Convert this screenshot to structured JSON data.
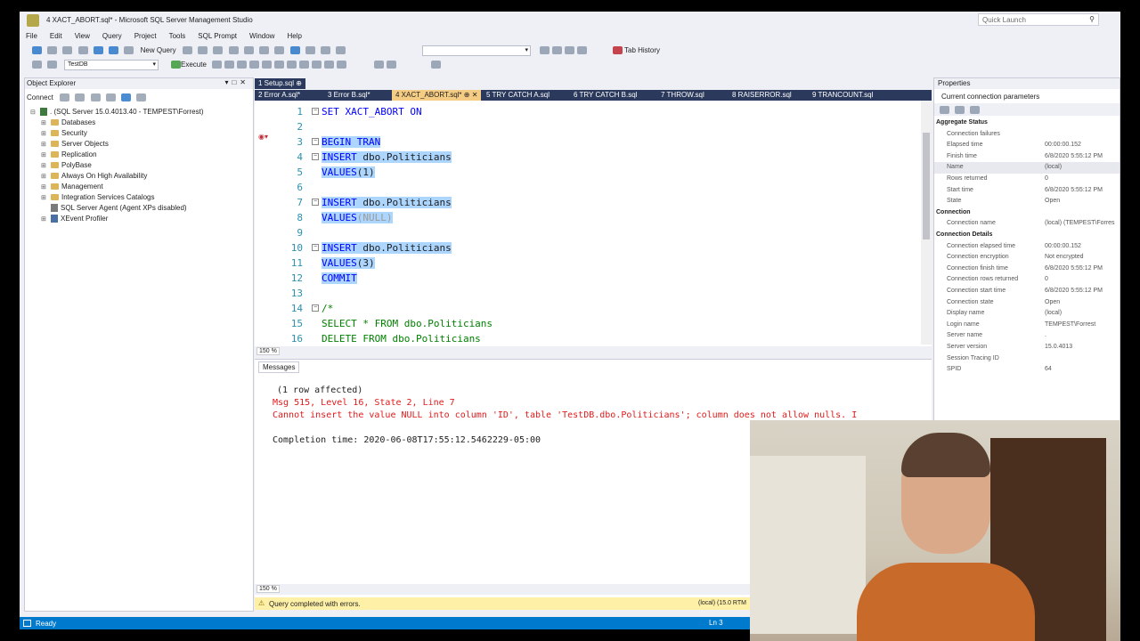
{
  "window": {
    "title": "4 XACT_ABORT.sql* - Microsoft SQL Server Management Studio",
    "quick_launch_placeholder": "Quick Launch"
  },
  "menu": [
    "File",
    "Edit",
    "View",
    "Query",
    "Project",
    "Tools",
    "SQL Prompt",
    "Window",
    "Help"
  ],
  "toolbar": {
    "new_query": "New Query",
    "tab_history": "Tab History",
    "database": "TestDB",
    "execute": "Execute"
  },
  "object_explorer": {
    "title": "Object Explorer",
    "connect": "Connect",
    "server": ". (SQL Server 15.0.4013.40 - TEMPEST\\Forrest)",
    "nodes": [
      "Databases",
      "Security",
      "Server Objects",
      "Replication",
      "PolyBase",
      "Always On High Availability",
      "Management",
      "Integration Services Catalogs"
    ],
    "agent": "SQL Server Agent (Agent XPs disabled)",
    "xevent": "XEvent Profiler"
  },
  "tabs": [
    {
      "label": "1 Setup.sql"
    },
    {
      "label": "2 Error A.sql*"
    },
    {
      "label": "3 Error B.sql*"
    },
    {
      "label": "4 XACT_ABORT.sql*"
    },
    {
      "label": "5 TRY CATCH A.sql"
    },
    {
      "label": "6 TRY CATCH B.sql"
    },
    {
      "label": "7 THROW.sql"
    },
    {
      "label": "8 RAISERROR.sql"
    },
    {
      "label": "9 TRANCOUNT.sql"
    }
  ],
  "editor": {
    "zoom": "150 %",
    "lines": [
      {
        "n": "1",
        "text": "SET XACT_ABORT ON"
      },
      {
        "n": "2",
        "text": ""
      },
      {
        "n": "3",
        "text": "BEGIN TRAN"
      },
      {
        "n": "4",
        "kw": "INSERT",
        "obj": "dbo.Politicians"
      },
      {
        "n": "5",
        "kw": "VALUES",
        "val": "(1)"
      },
      {
        "n": "6",
        "text": ""
      },
      {
        "n": "7",
        "kw": "INSERT",
        "obj": "dbo.Politicians"
      },
      {
        "n": "8",
        "kw": "VALUES",
        "val": "(NULL)"
      },
      {
        "n": "9",
        "text": ""
      },
      {
        "n": "10",
        "kw": "INSERT",
        "obj": "dbo.Politicians"
      },
      {
        "n": "11",
        "kw": "VALUES",
        "val": "(3)"
      },
      {
        "n": "12",
        "text": "COMMIT"
      },
      {
        "n": "13",
        "text": ""
      },
      {
        "n": "14",
        "text": "/*"
      },
      {
        "n": "15",
        "text": "SELECT * FROM dbo.Politicians"
      },
      {
        "n": "16",
        "text": "DELETE FROM dbo.Politicians"
      }
    ]
  },
  "results": {
    "tab": "Messages",
    "line1": "(1 row affected)",
    "line2": "Msg 515, Level 16, State 2, Line 7",
    "line3": "Cannot insert the value NULL into column 'ID', table 'TestDB.dbo.Politicians'; column does not allow nulls. I",
    "line4": "Completion time: 2020-06-08T17:55:12.5462229-05:00",
    "zoom": "150 %",
    "status": "Query completed with errors.",
    "connection": "(local) (15.0 RTM"
  },
  "properties": {
    "title": "Properties",
    "subtitle": "Current connection parameters",
    "rows": [
      {
        "cat": true,
        "k": "Aggregate Status"
      },
      {
        "k": "Connection failures",
        "v": ""
      },
      {
        "k": "Elapsed time",
        "v": "00:00:00.152"
      },
      {
        "k": "Finish time",
        "v": "6/8/2020 5:55:12 PM"
      },
      {
        "k": "Name",
        "v": "(local)",
        "hl": true
      },
      {
        "k": "Rows returned",
        "v": "0"
      },
      {
        "k": "Start time",
        "v": "6/8/2020 5:55:12 PM"
      },
      {
        "k": "State",
        "v": "Open"
      },
      {
        "cat": true,
        "k": "Connection"
      },
      {
        "k": "Connection name",
        "v": "(local) (TEMPEST\\Forres"
      },
      {
        "cat": true,
        "k": "Connection Details"
      },
      {
        "k": "Connection elapsed time",
        "v": "00:00:00.152"
      },
      {
        "k": "Connection encryption",
        "v": "Not encrypted"
      },
      {
        "k": "Connection finish time",
        "v": "6/8/2020 5:55:12 PM"
      },
      {
        "k": "Connection rows returned",
        "v": "0"
      },
      {
        "k": "Connection start time",
        "v": "6/8/2020 5:55:12 PM"
      },
      {
        "k": "Connection state",
        "v": "Open"
      },
      {
        "k": "Display name",
        "v": "(local)"
      },
      {
        "k": "Login name",
        "v": "TEMPEST\\Forrest"
      },
      {
        "k": "Server name",
        "v": "."
      },
      {
        "k": "Server version",
        "v": "15.0.4013"
      },
      {
        "k": "Session Tracing ID",
        "v": ""
      },
      {
        "k": "SPID",
        "v": "64"
      }
    ]
  },
  "statusbar": {
    "ready": "Ready",
    "ln": "Ln 3"
  },
  "colors": {
    "accent": "#007acc",
    "tab_bar": "#2b3a5c",
    "active_tab": "#f5cc84",
    "selection": "#add6ff",
    "error_text": "#e01a1a",
    "keyword": "#0000ff"
  }
}
